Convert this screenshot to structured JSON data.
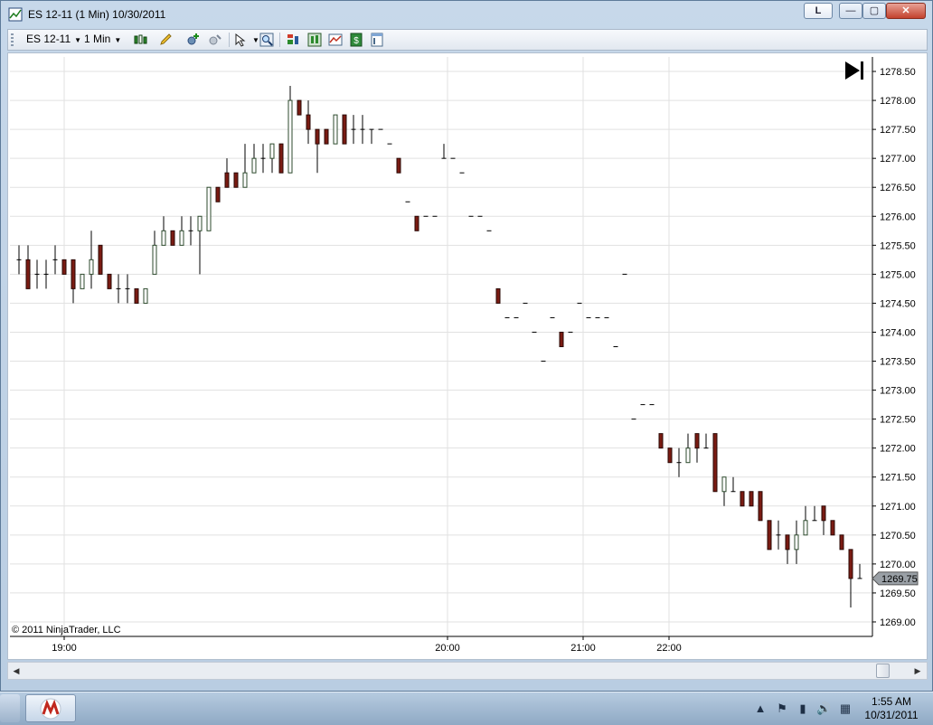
{
  "window": {
    "title": "ES 12-11 (1 Min)  10/30/2011",
    "layout_button": "L",
    "minimize_glyph": "—",
    "maximize_glyph": "▢",
    "close_glyph": "✕"
  },
  "toolbar": {
    "instrument": "ES 12-11",
    "interval": "1 Min",
    "icons": [
      "bar-type-icon",
      "drawing-pencil-icon",
      "indicator-add-icon",
      "strategy-icon",
      "pointer-icon",
      "zoom-icon",
      "data-series-icon",
      "chart-style-icon",
      "chart-properties-icon",
      "account-data-icon",
      "properties-icon"
    ]
  },
  "colors": {
    "up_body": "#ffffff",
    "up_border": "#2c4a2c",
    "down_body": "#7a1b12",
    "grid": "#e1e1e1",
    "price_marker": "#9aa0a6"
  },
  "chart_data": {
    "type": "candlestick",
    "instrument": "ES 12-11",
    "interval": "1 Min",
    "copyright": "© 2011 NinjaTrader, LLC",
    "ylim": [
      1268.75,
      1278.75
    ],
    "y_ticks": [
      "1269.00",
      "1269.50",
      "1270.00",
      "1270.50",
      "1271.00",
      "1271.50",
      "1272.00",
      "1272.50",
      "1273.00",
      "1273.50",
      "1274.00",
      "1274.50",
      "1275.00",
      "1275.50",
      "1276.00",
      "1276.50",
      "1277.00",
      "1277.50",
      "1278.00",
      "1278.50"
    ],
    "x_ticks": [
      "19:00",
      "20:00",
      "21:00",
      "22:00"
    ],
    "last_price": "1269.75",
    "grid": true,
    "candles": [
      [
        1275.25,
        1275.5,
        1275.0,
        1275.25
      ],
      [
        1275.25,
        1275.5,
        1274.75,
        1274.75
      ],
      [
        1275.0,
        1275.25,
        1274.75,
        1275.0
      ],
      [
        1275.0,
        1275.25,
        1274.75,
        1275.0
      ],
      [
        1275.25,
        1275.5,
        1275.0,
        1275.25
      ],
      [
        1275.25,
        1275.25,
        1275.0,
        1275.0
      ],
      [
        1275.25,
        1275.25,
        1274.5,
        1274.75
      ],
      [
        1274.75,
        1275.0,
        1274.75,
        1275.0
      ],
      [
        1275.0,
        1275.75,
        1274.75,
        1275.25
      ],
      [
        1275.5,
        1275.5,
        1275.0,
        1275.0
      ],
      [
        1275.0,
        1275.0,
        1274.75,
        1274.75
      ],
      [
        1274.75,
        1275.0,
        1274.5,
        1274.75
      ],
      [
        1274.75,
        1275.0,
        1274.5,
        1274.75
      ],
      [
        1274.75,
        1274.75,
        1274.5,
        1274.5
      ],
      [
        1274.5,
        1274.75,
        1274.5,
        1274.75
      ],
      [
        1275.0,
        1275.75,
        1275.0,
        1275.5
      ],
      [
        1275.5,
        1276.0,
        1275.5,
        1275.75
      ],
      [
        1275.75,
        1275.75,
        1275.5,
        1275.5
      ],
      [
        1275.5,
        1276.0,
        1275.5,
        1275.75
      ],
      [
        1275.75,
        1276.0,
        1275.5,
        1275.75
      ],
      [
        1275.75,
        1276.0,
        1275.0,
        1276.0
      ],
      [
        1275.75,
        1276.5,
        1275.75,
        1276.5
      ],
      [
        1276.5,
        1276.5,
        1276.25,
        1276.25
      ],
      [
        1276.75,
        1277.0,
        1276.5,
        1276.5
      ],
      [
        1276.75,
        1276.75,
        1276.5,
        1276.5
      ],
      [
        1276.5,
        1277.25,
        1276.5,
        1276.75
      ],
      [
        1276.75,
        1277.25,
        1276.75,
        1277.0
      ],
      [
        1277.0,
        1277.25,
        1276.75,
        1277.0
      ],
      [
        1277.0,
        1277.25,
        1276.75,
        1277.25
      ],
      [
        1277.25,
        1277.25,
        1276.75,
        1276.75
      ],
      [
        1276.75,
        1278.25,
        1276.75,
        1278.0
      ],
      [
        1278.0,
        1278.0,
        1277.75,
        1277.75
      ],
      [
        1277.75,
        1278.0,
        1277.25,
        1277.5
      ],
      [
        1277.5,
        1277.5,
        1276.75,
        1277.25
      ],
      [
        1277.5,
        1277.5,
        1277.25,
        1277.25
      ],
      [
        1277.25,
        1277.75,
        1277.25,
        1277.75
      ],
      [
        1277.75,
        1277.75,
        1277.25,
        1277.25
      ],
      [
        1277.5,
        1277.75,
        1277.25,
        1277.5
      ],
      [
        1277.5,
        1277.75,
        1277.25,
        1277.5
      ],
      [
        1277.5,
        1277.5,
        1277.25,
        1277.5
      ],
      [
        1277.5,
        1277.5,
        1277.5,
        1277.5
      ],
      [
        1277.25,
        1277.25,
        1277.25,
        1277.25
      ],
      [
        1277.0,
        1277.0,
        1276.75,
        1276.75
      ],
      [
        1276.25,
        1276.25,
        1276.25,
        1276.25
      ],
      [
        1276.0,
        1276.0,
        1275.75,
        1275.75
      ],
      [
        1276.0,
        1276.0,
        1276.0,
        1276.0
      ],
      [
        1276.0,
        1276.0,
        1276.0,
        1276.0
      ],
      [
        1277.0,
        1277.25,
        1277.0,
        1277.0
      ],
      [
        1277.0,
        1277.0,
        1277.0,
        1277.0
      ],
      [
        1276.75,
        1276.75,
        1276.75,
        1276.75
      ],
      [
        1276.0,
        1276.0,
        1276.0,
        1276.0
      ],
      [
        1276.0,
        1276.0,
        1276.0,
        1276.0
      ],
      [
        1275.75,
        1275.75,
        1275.75,
        1275.75
      ],
      [
        1274.75,
        1274.75,
        1274.5,
        1274.5
      ],
      [
        1274.25,
        1274.25,
        1274.25,
        1274.25
      ],
      [
        1274.25,
        1274.25,
        1274.25,
        1274.25
      ],
      [
        1274.5,
        1274.5,
        1274.5,
        1274.5
      ],
      [
        1274.0,
        1274.0,
        1274.0,
        1274.0
      ],
      [
        1273.5,
        1273.5,
        1273.5,
        1273.5
      ],
      [
        1274.25,
        1274.25,
        1274.25,
        1274.25
      ],
      [
        1274.0,
        1274.0,
        1273.75,
        1273.75
      ],
      [
        1274.0,
        1274.0,
        1274.0,
        1274.0
      ],
      [
        1274.5,
        1274.5,
        1274.5,
        1274.5
      ],
      [
        1274.25,
        1274.25,
        1274.25,
        1274.25
      ],
      [
        1274.25,
        1274.25,
        1274.25,
        1274.25
      ],
      [
        1274.25,
        1274.25,
        1274.25,
        1274.25
      ],
      [
        1273.75,
        1273.75,
        1273.75,
        1273.75
      ],
      [
        1275.0,
        1275.0,
        1275.0,
        1275.0
      ],
      [
        1272.5,
        1272.5,
        1272.5,
        1272.5
      ],
      [
        1272.75,
        1272.75,
        1272.75,
        1272.75
      ],
      [
        1272.75,
        1272.75,
        1272.75,
        1272.75
      ],
      [
        1272.25,
        1272.25,
        1272.0,
        1272.0
      ],
      [
        1272.0,
        1272.0,
        1271.75,
        1271.75
      ],
      [
        1271.75,
        1272.0,
        1271.5,
        1271.75
      ],
      [
        1271.75,
        1272.25,
        1271.75,
        1272.0
      ],
      [
        1272.25,
        1272.25,
        1271.75,
        1272.0
      ],
      [
        1272.0,
        1272.25,
        1272.0,
        1272.0
      ],
      [
        1272.25,
        1272.25,
        1271.25,
        1271.25
      ],
      [
        1271.25,
        1271.5,
        1271.0,
        1271.5
      ],
      [
        1271.25,
        1271.5,
        1271.25,
        1271.25
      ],
      [
        1271.25,
        1271.25,
        1271.0,
        1271.0
      ],
      [
        1271.25,
        1271.25,
        1271.0,
        1271.0
      ],
      [
        1271.25,
        1271.25,
        1270.75,
        1270.75
      ],
      [
        1270.75,
        1270.75,
        1270.25,
        1270.25
      ],
      [
        1270.5,
        1270.75,
        1270.25,
        1270.5
      ],
      [
        1270.5,
        1270.5,
        1270.0,
        1270.25
      ],
      [
        1270.25,
        1270.75,
        1270.0,
        1270.5
      ],
      [
        1270.5,
        1271.0,
        1270.5,
        1270.75
      ],
      [
        1270.75,
        1271.0,
        1270.75,
        1270.75
      ],
      [
        1271.0,
        1271.0,
        1270.5,
        1270.75
      ],
      [
        1270.75,
        1270.75,
        1270.5,
        1270.5
      ],
      [
        1270.5,
        1270.5,
        1270.25,
        1270.25
      ],
      [
        1270.25,
        1270.25,
        1269.25,
        1269.75
      ],
      [
        1269.75,
        1270.0,
        1269.75,
        1269.75
      ]
    ]
  },
  "scrollbar": {
    "left_glyph": "◀",
    "right_glyph": "▶"
  },
  "taskbar": {
    "clock_time": "1:55 AM",
    "clock_date": "10/31/2011",
    "tray": [
      {
        "name": "show-hidden-icon",
        "glyph": "▲"
      },
      {
        "name": "flag-icon",
        "glyph": "⚑"
      },
      {
        "name": "battery-icon",
        "glyph": "▮"
      },
      {
        "name": "volume-icon",
        "glyph": "🔊"
      },
      {
        "name": "network-icon",
        "glyph": "▦"
      }
    ]
  }
}
